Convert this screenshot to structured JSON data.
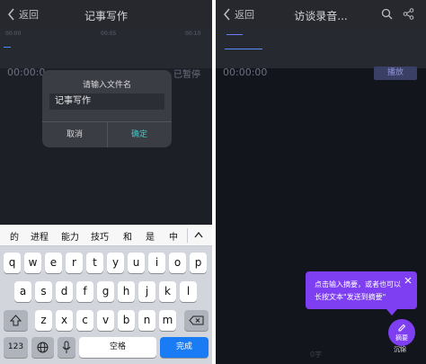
{
  "left_screen": {
    "nav": {
      "back_label": "返回",
      "title": "记事写作"
    },
    "waveform": {
      "tick_labels": [
        "00:00",
        "00:05",
        "00:10"
      ]
    },
    "timestamp": "00:00:0",
    "status": "已暂停",
    "dialog": {
      "title": "请输入文件名",
      "input_value": "记事写作",
      "cancel_label": "取消",
      "confirm_label": "确定"
    },
    "keyboard": {
      "candidates": [
        "的",
        "进程",
        "能力",
        "技巧",
        "和",
        "是",
        "中"
      ],
      "collapse_icon": "chevron-up",
      "row1": [
        "q",
        "w",
        "e",
        "r",
        "t",
        "y",
        "u",
        "i",
        "o",
        "p"
      ],
      "row2": [
        "a",
        "s",
        "d",
        "f",
        "g",
        "h",
        "j",
        "k",
        "l"
      ],
      "row3": [
        "z",
        "x",
        "c",
        "v",
        "b",
        "n",
        "m"
      ],
      "num_label": "123",
      "space_label": "空格",
      "done_label": "完成",
      "colors": {
        "done": "#1a7cf5"
      }
    }
  },
  "right_screen": {
    "nav": {
      "back_label": "返回",
      "title": "访谈录音..."
    },
    "timestamp": "00:00:00",
    "play_label": "播放",
    "tooltip": "点击输入摘要，或者也可以长按文本\"发送到摘要\"",
    "fab_label": "摘要",
    "bottom_time": "0字",
    "colors": {
      "accent": "#7e3ff2"
    }
  },
  "watermark": "沉锦"
}
